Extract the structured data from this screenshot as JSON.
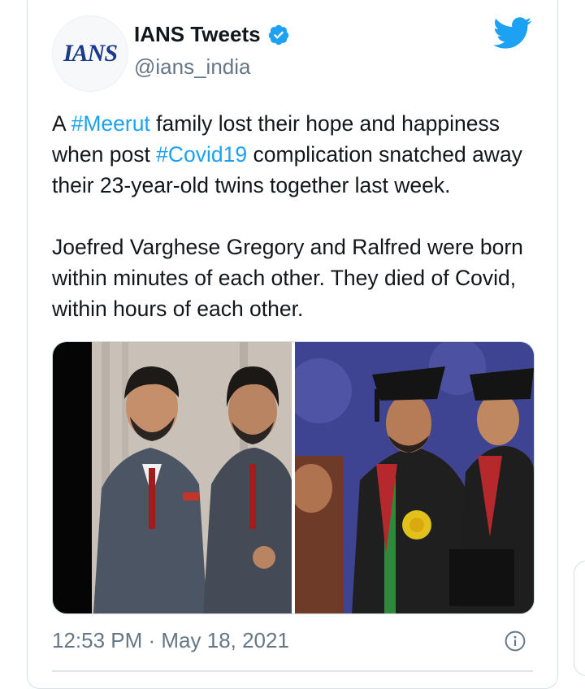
{
  "tweet": {
    "avatar_text": "IANS",
    "display_name": "IANS Tweets",
    "handle": "@ians_india",
    "paragraph1": {
      "t1": "A ",
      "tag1": "#Meerut",
      "t2": " family lost their hope and happiness when post ",
      "tag2": "#Covid19",
      "t3": " complication snatched away their 23-year-old twins together last week."
    },
    "paragraph2": "Joefred Varghese Gregory and Ralfred were born within minutes of each other. They died of Covid, within hours of each other.",
    "timestamp": "12:53 PM · May 18, 2021"
  },
  "icons": {
    "verified": "verified-badge-icon",
    "platform": "twitter-bird-icon",
    "info": "info-icon"
  },
  "colors": {
    "hashtag": "#1da1f2",
    "verified": "#1da1f2",
    "bird": "#1da1f2",
    "secondary_text": "#657786"
  }
}
